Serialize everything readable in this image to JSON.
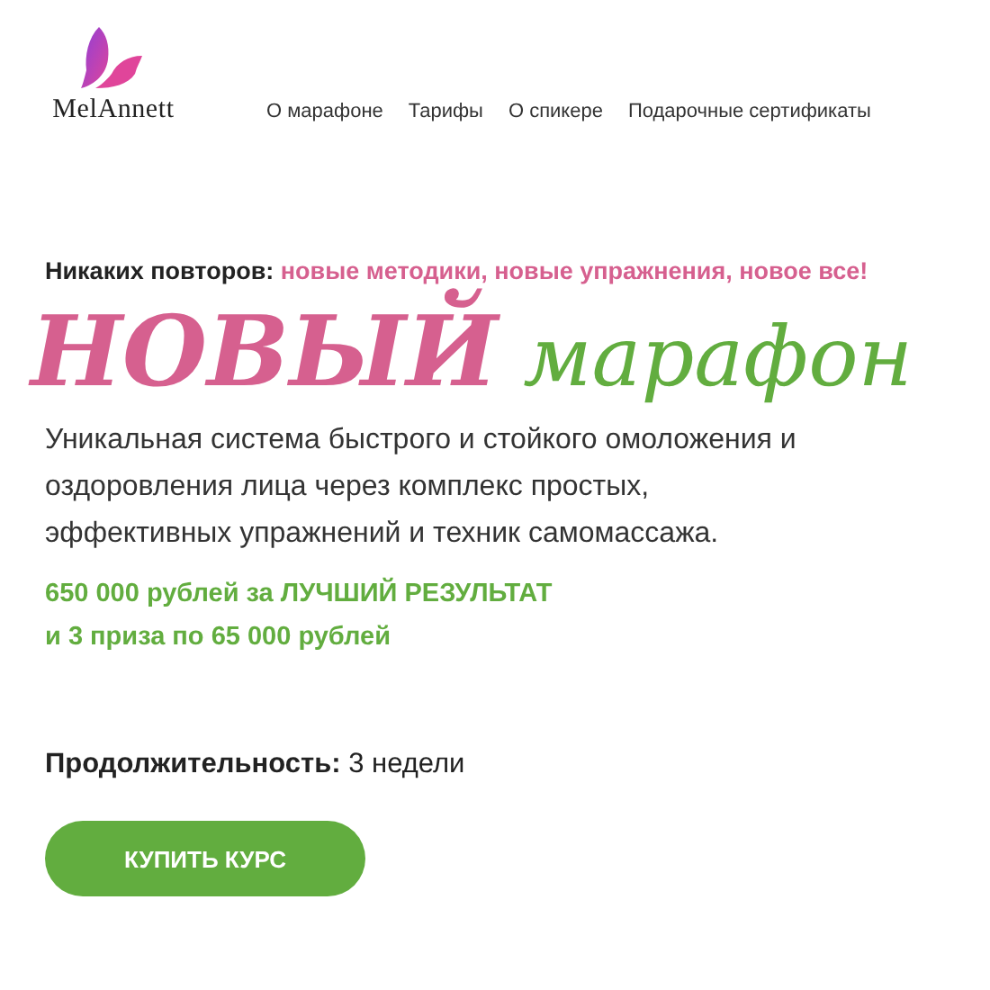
{
  "logo": {
    "text": "MelAnnett"
  },
  "nav": [
    {
      "label": "О марафоне"
    },
    {
      "label": "Тарифы"
    },
    {
      "label": "О спикере"
    },
    {
      "label": "Подарочные сертификаты"
    }
  ],
  "tagline": {
    "lead": "Никаких повторов:",
    "highlight": "новые методики, новые упражнения, новое все!"
  },
  "title_words": [
    {
      "text": "НОВЫЙ",
      "color": "#d6608f"
    },
    {
      "text": "марафон",
      "color": "#62ad3f"
    }
  ],
  "description": "Уникальная система быстрого и стойкого омоложения и оздоровления лица через комплекс простых, эффективных упражнений и техник самомассажа.",
  "prize_lines": [
    "650 000 рублей за ЛУЧШИЙ РЕЗУЛЬТАТ",
    "и 3 приза по 65 000 рублей"
  ],
  "duration": {
    "label": "Продолжительность:",
    "value": "3 недели"
  },
  "buy_button": {
    "label": "КУПИТЬ КУРС"
  }
}
